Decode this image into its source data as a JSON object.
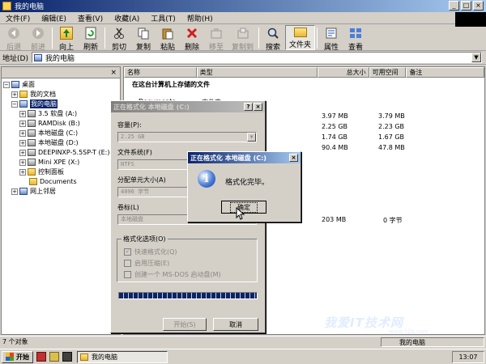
{
  "window": {
    "title": "我的电脑",
    "menu": [
      "文件(F)",
      "编辑(E)",
      "查看(V)",
      "收藏(A)",
      "工具(T)",
      "帮助(H)"
    ],
    "toolbar": [
      {
        "label": "后退",
        "icon": "back-icon",
        "disabled": true
      },
      {
        "label": "前进",
        "icon": "forward-icon",
        "disabled": true
      },
      {
        "label": "向上",
        "icon": "up-icon",
        "disabled": false
      },
      {
        "label": "刷新",
        "icon": "refresh-icon",
        "disabled": false
      },
      {
        "label": "剪切",
        "icon": "cut-icon",
        "disabled": false
      },
      {
        "label": "复制",
        "icon": "copy-icon",
        "disabled": false
      },
      {
        "label": "粘贴",
        "icon": "paste-icon",
        "disabled": false
      },
      {
        "label": "删除",
        "icon": "delete-icon",
        "disabled": false
      },
      {
        "label": "移至",
        "icon": "move-to-icon",
        "disabled": true
      },
      {
        "label": "复制到",
        "icon": "copy-to-icon",
        "disabled": true
      },
      {
        "label": "搜索",
        "icon": "search-icon",
        "disabled": false
      },
      {
        "label": "文件夹",
        "icon": "folders-icon",
        "disabled": false
      },
      {
        "label": "属性",
        "icon": "properties-icon",
        "disabled": false
      },
      {
        "label": "查看",
        "icon": "views-icon",
        "disabled": false
      }
    ],
    "address_label": "地址(D)",
    "address_value": "我的电脑"
  },
  "tree": {
    "items": [
      {
        "label": "桌面",
        "expander": "−"
      },
      {
        "label": "我的文档",
        "expander": "+"
      },
      {
        "label": "我的电脑",
        "expander": "−"
      },
      {
        "label": "3.5 软盘 (A:)",
        "expander": "+"
      },
      {
        "label": "RAMDisk (B:)",
        "expander": "+"
      },
      {
        "label": "本地磁盘 (C:)",
        "expander": "+"
      },
      {
        "label": "本地磁盘 (D:)",
        "expander": "+"
      },
      {
        "label": "DEEPINXP-5.5SP-T (E:)",
        "expander": "+"
      },
      {
        "label": "Mini XPE (X:)",
        "expander": "+"
      },
      {
        "label": "控制面板",
        "expander": "+"
      },
      {
        "label": "Documents",
        "expander": ""
      },
      {
        "label": "网上邻居",
        "expander": "+"
      }
    ]
  },
  "list": {
    "columns": [
      "名称",
      "类型",
      "总大小",
      "可用空间",
      "备注"
    ],
    "section": "在这台计算机上存储的文件",
    "partial_row": {
      "name": "Documents",
      "type": "文件夹"
    },
    "rows": [
      {
        "total": "3.97 MB",
        "free": "3.79 MB"
      },
      {
        "total": "2.25 GB",
        "free": "2.23 GB"
      },
      {
        "total": "1.74 GB",
        "free": "1.67 GB"
      },
      {
        "total": "90.4 MB",
        "free": "47.8 MB"
      },
      {
        "total": "203 MB",
        "free": "0 字节"
      }
    ]
  },
  "format_dialog": {
    "title": "正在格式化 本地磁盘 (C:)",
    "capacity_label": "容量(P):",
    "capacity_value": "2.25 GB",
    "fs_label": "文件系统(F)",
    "fs_value": "NTFS",
    "alloc_label": "分配单元大小(A)",
    "alloc_value": "4096 字节",
    "volume_label": "卷标(L)",
    "volume_value": "本地磁盘",
    "options_label": "格式化选项(O)",
    "opt_quick": "快速格式化(Q)",
    "opt_compress": "启用压缩(E)",
    "opt_msdos": "创建一个 MS-DOS 启动盘(M)",
    "start_btn": "开始(S)",
    "cancel_btn": "取消",
    "progress": 1.0
  },
  "msg_dialog": {
    "title": "正在格式化 本地磁盘 (C:)",
    "message": "格式化完毕。",
    "ok_btn": "确定"
  },
  "status": {
    "count": "7 个对象",
    "location": "我的电脑"
  },
  "taskbar": {
    "start": "开始",
    "task": "我的电脑",
    "clock": "13:07"
  },
  "watermark": {
    "text": "我爱IT技术网",
    "url": "www.52ij.com"
  }
}
